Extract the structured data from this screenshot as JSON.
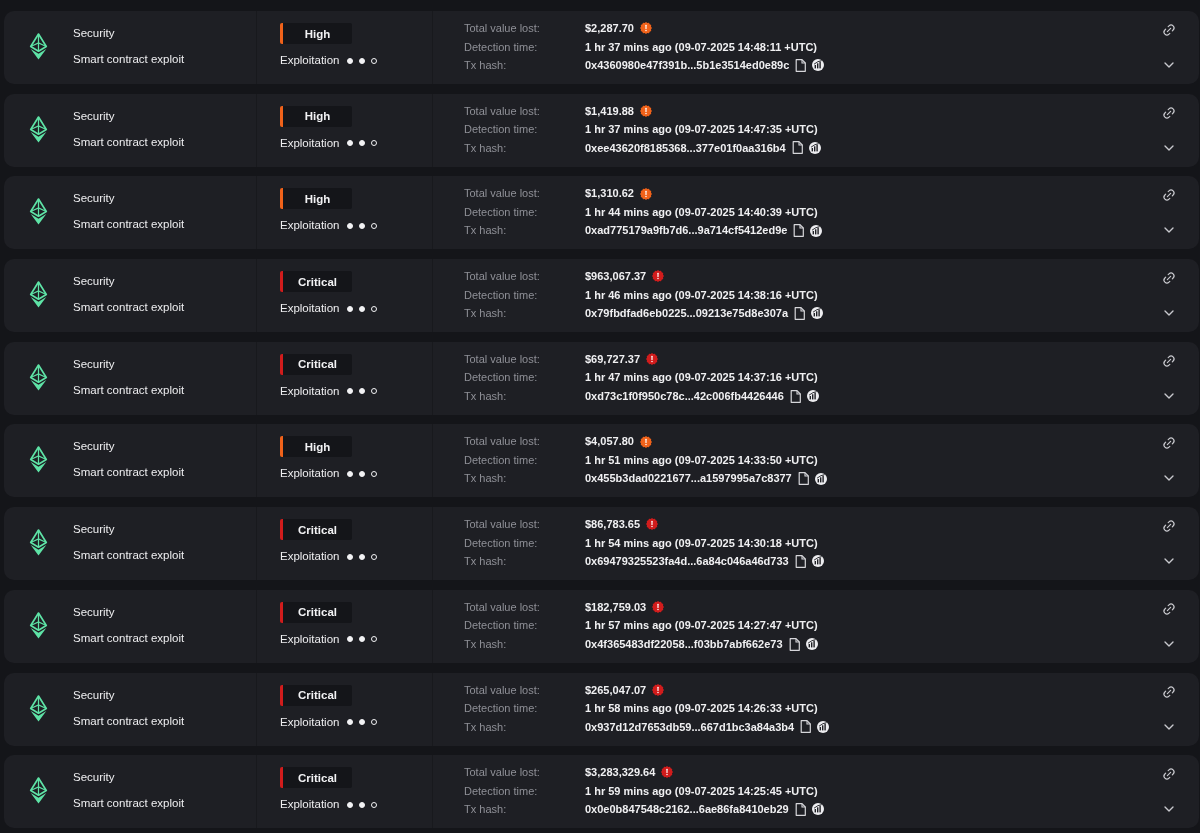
{
  "alerts": [
    {
      "category": "Security",
      "title": "Smart contract exploit",
      "severity": {
        "label": "High",
        "kind": "high"
      },
      "exploitation": {
        "label": "Exploitation",
        "stars": 2
      },
      "value_lost": {
        "label": "Total value lost:",
        "value": "$2,287.70"
      },
      "detection_time": {
        "label": "Detection time:",
        "value": "1 hr 37 mins ago (09-07-2025 14:48:11 +UTC)"
      },
      "tx_hash": {
        "label": "Tx hash:",
        "value": "0x4360980e47f391b...5b1e3514ed0e89c"
      }
    },
    {
      "category": "Security",
      "title": "Smart contract exploit",
      "severity": {
        "label": "High",
        "kind": "high"
      },
      "exploitation": {
        "label": "Exploitation",
        "stars": 2
      },
      "value_lost": {
        "label": "Total value lost:",
        "value": "$1,419.88"
      },
      "detection_time": {
        "label": "Detection time:",
        "value": "1 hr 37 mins ago (09-07-2025 14:47:35 +UTC)"
      },
      "tx_hash": {
        "label": "Tx hash:",
        "value": "0xee43620f8185368...377e01f0aa316b4"
      }
    },
    {
      "category": "Security",
      "title": "Smart contract exploit",
      "severity": {
        "label": "High",
        "kind": "high"
      },
      "exploitation": {
        "label": "Exploitation",
        "stars": 2
      },
      "value_lost": {
        "label": "Total value lost:",
        "value": "$1,310.62"
      },
      "detection_time": {
        "label": "Detection time:",
        "value": "1 hr 44 mins ago (09-07-2025 14:40:39 +UTC)"
      },
      "tx_hash": {
        "label": "Tx hash:",
        "value": "0xad775179a9fb7d6...9a714cf5412ed9e"
      }
    },
    {
      "category": "Security",
      "title": "Smart contract exploit",
      "severity": {
        "label": "Critical",
        "kind": "critical"
      },
      "exploitation": {
        "label": "Exploitation",
        "stars": 2
      },
      "value_lost": {
        "label": "Total value lost:",
        "value": "$963,067.37"
      },
      "detection_time": {
        "label": "Detection time:",
        "value": "1 hr 46 mins ago (09-07-2025 14:38:16 +UTC)"
      },
      "tx_hash": {
        "label": "Tx hash:",
        "value": "0x79fbdfad6eb0225...09213e75d8e307a"
      }
    },
    {
      "category": "Security",
      "title": "Smart contract exploit",
      "severity": {
        "label": "Critical",
        "kind": "critical"
      },
      "exploitation": {
        "label": "Exploitation",
        "stars": 2
      },
      "value_lost": {
        "label": "Total value lost:",
        "value": "$69,727.37"
      },
      "detection_time": {
        "label": "Detection time:",
        "value": "1 hr 47 mins ago (09-07-2025 14:37:16 +UTC)"
      },
      "tx_hash": {
        "label": "Tx hash:",
        "value": "0xd73c1f0f950c78c...42c006fb4426446"
      }
    },
    {
      "category": "Security",
      "title": "Smart contract exploit",
      "severity": {
        "label": "High",
        "kind": "high"
      },
      "exploitation": {
        "label": "Exploitation",
        "stars": 2
      },
      "value_lost": {
        "label": "Total value lost:",
        "value": "$4,057.80"
      },
      "detection_time": {
        "label": "Detection time:",
        "value": "1 hr 51 mins ago (09-07-2025 14:33:50 +UTC)"
      },
      "tx_hash": {
        "label": "Tx hash:",
        "value": "0x455b3dad0221677...a1597995a7c8377"
      }
    },
    {
      "category": "Security",
      "title": "Smart contract exploit",
      "severity": {
        "label": "Critical",
        "kind": "critical"
      },
      "exploitation": {
        "label": "Exploitation",
        "stars": 2
      },
      "value_lost": {
        "label": "Total value lost:",
        "value": "$86,783.65"
      },
      "detection_time": {
        "label": "Detection time:",
        "value": "1 hr 54 mins ago (09-07-2025 14:30:18 +UTC)"
      },
      "tx_hash": {
        "label": "Tx hash:",
        "value": "0x69479325523fa4d...6a84c046a46d733"
      }
    },
    {
      "category": "Security",
      "title": "Smart contract exploit",
      "severity": {
        "label": "Critical",
        "kind": "critical"
      },
      "exploitation": {
        "label": "Exploitation",
        "stars": 2
      },
      "value_lost": {
        "label": "Total value lost:",
        "value": "$182,759.03"
      },
      "detection_time": {
        "label": "Detection time:",
        "value": "1 hr 57 mins ago (09-07-2025 14:27:47 +UTC)"
      },
      "tx_hash": {
        "label": "Tx hash:",
        "value": "0x4f365483df22058...f03bb7abf662e73"
      }
    },
    {
      "category": "Security",
      "title": "Smart contract exploit",
      "severity": {
        "label": "Critical",
        "kind": "critical"
      },
      "exploitation": {
        "label": "Exploitation",
        "stars": 2
      },
      "value_lost": {
        "label": "Total value lost:",
        "value": "$265,047.07"
      },
      "detection_time": {
        "label": "Detection time:",
        "value": "1 hr 58 mins ago (09-07-2025 14:26:33 +UTC)"
      },
      "tx_hash": {
        "label": "Tx hash:",
        "value": "0x937d12d7653db59...667d1bc3a84a3b4"
      }
    },
    {
      "category": "Security",
      "title": "Smart contract exploit",
      "severity": {
        "label": "Critical",
        "kind": "critical"
      },
      "exploitation": {
        "label": "Exploitation",
        "stars": 2
      },
      "value_lost": {
        "label": "Total value lost:",
        "value": "$3,283,329.64"
      },
      "detection_time": {
        "label": "Detection time:",
        "value": "1 hr 59 mins ago (09-07-2025 14:25:45 +UTC)"
      },
      "tx_hash": {
        "label": "Tx hash:",
        "value": "0x0e0b847548c2162...6ae86fa8410eb29"
      }
    }
  ]
}
